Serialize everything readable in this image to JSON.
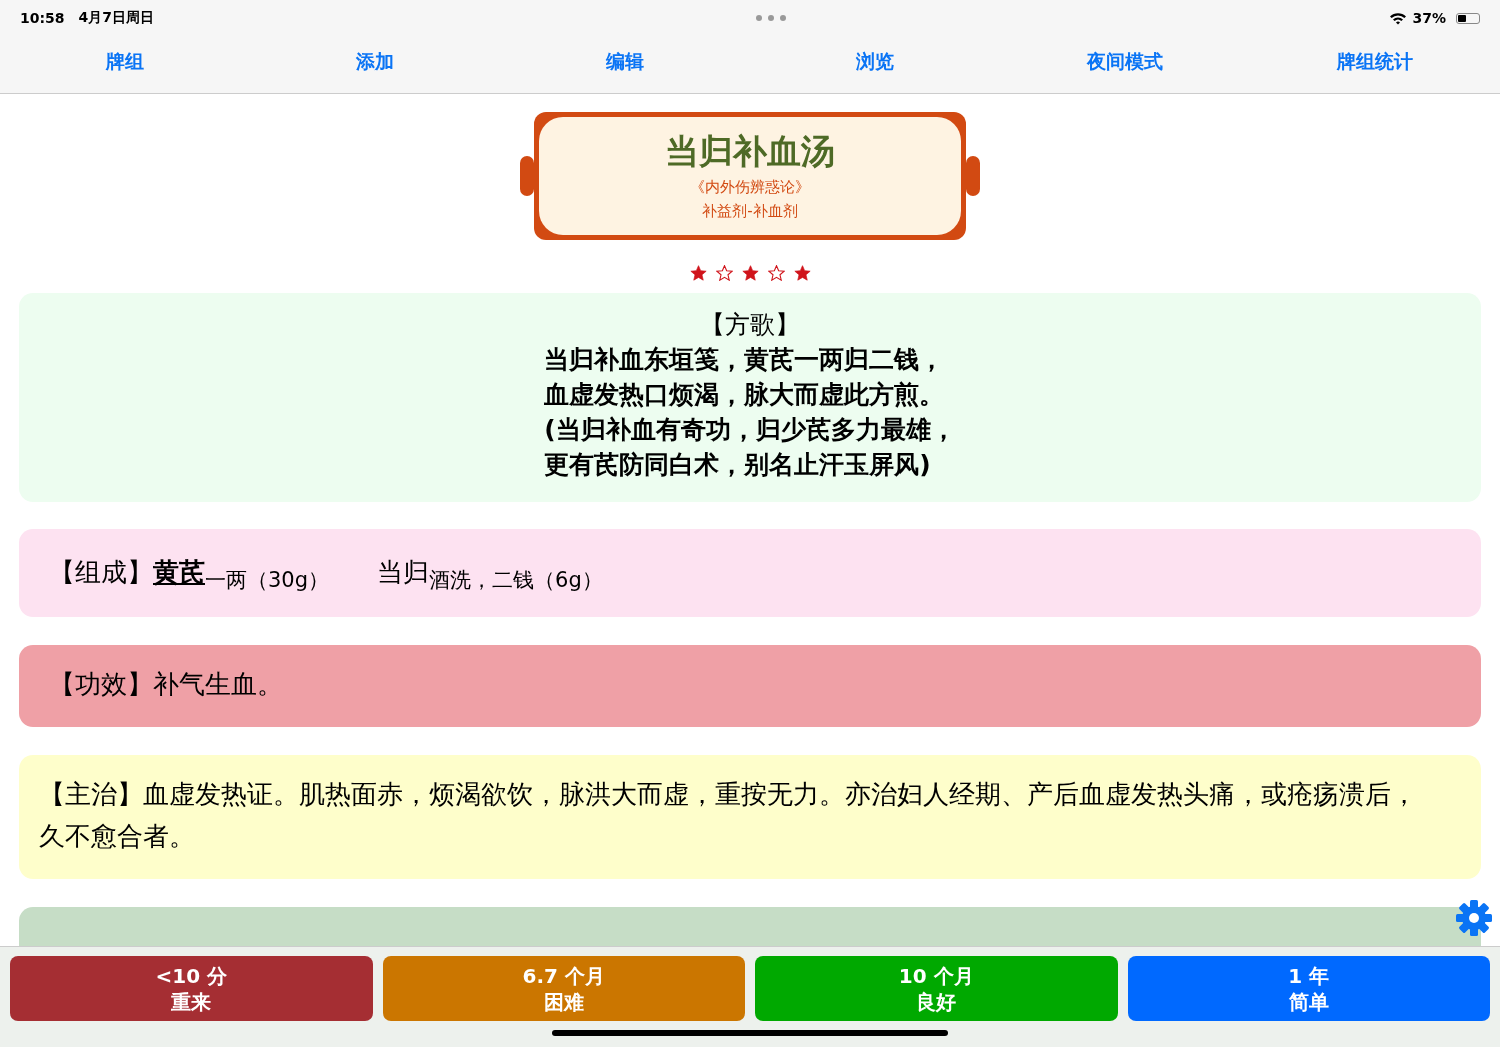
{
  "status_bar": {
    "time": "10:58",
    "date": "4月7日周日",
    "battery": "37%"
  },
  "tabs": [
    {
      "label": "牌组"
    },
    {
      "label": "添加"
    },
    {
      "label": "编辑"
    },
    {
      "label": "浏览"
    },
    {
      "label": "夜间模式"
    },
    {
      "label": "牌组统计"
    }
  ],
  "card": {
    "title": "当归补血汤",
    "source": "《内外伤辨惑论》",
    "category": "补益剂-补血剂",
    "rating": [
      {
        "filled": true
      },
      {
        "filled": false
      },
      {
        "filled": true
      },
      {
        "filled": false
      },
      {
        "filled": true
      }
    ],
    "song": {
      "heading": "【方歌】",
      "lines": [
        "当归补血东垣笺，黄芪一两归二钱，",
        "血虚发热口烦渴，脉大而虚此方煎。",
        "(当归补血有奇功，归少芪多力最雄，",
        "更有芪防同白术，别名止汗玉屏风)"
      ]
    },
    "composition": {
      "label": "【组成】",
      "items": [
        {
          "name": "黄芪",
          "emphasized": true,
          "dose": "一两（30g）"
        },
        {
          "name": "当归",
          "emphasized": false,
          "dose": "酒洗，二钱（6g）"
        }
      ]
    },
    "sections": [
      {
        "kind": "effect",
        "color": "#efa0a6",
        "text": "【功效】补气生血。"
      },
      {
        "kind": "indication",
        "color": "#fefecb",
        "text": "【主治】血虚发热证。肌热面赤，烦渴欲饮，脉洪大而虚，重按无力。亦治妇人经期、产后血虚发热头痛，或疮疡溃后，久不愈合者。"
      }
    ]
  },
  "answer_buttons": [
    {
      "interval": "<10 分",
      "label": "重来",
      "color": "#a52e33"
    },
    {
      "interval": "6.7 个月",
      "label": "困难",
      "color": "#cb7600"
    },
    {
      "interval": "10 个月",
      "label": "良好",
      "color": "#00a900"
    },
    {
      "interval": "1 年",
      "label": "简单",
      "color": "#0069ff"
    }
  ]
}
